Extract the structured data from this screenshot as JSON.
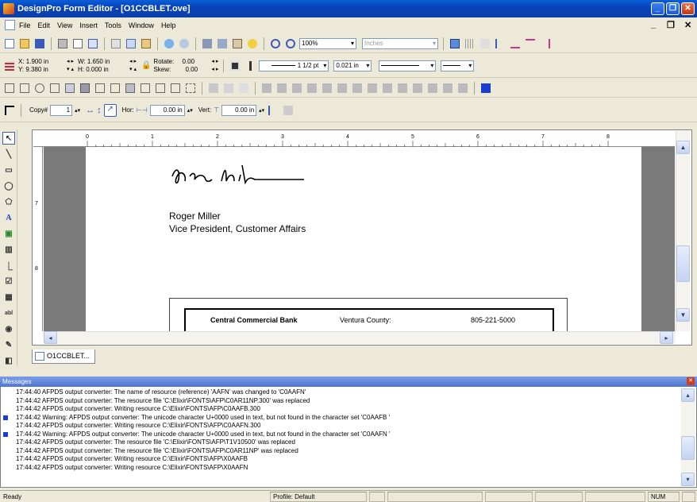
{
  "window": {
    "title": "DesignPro Form Editor - [O1CCBLET.ove]"
  },
  "menu": [
    "File",
    "Edit",
    "View",
    "Insert",
    "Tools",
    "Window",
    "Help"
  ],
  "toolbar1": {
    "zoom": "100%",
    "units": "Inches"
  },
  "toolbar2": {
    "x_label": "X:",
    "x_value": "1.900 in",
    "y_label": "Y:",
    "y_value": "9.380 in",
    "w_label": "W:",
    "w_value": "1.650 in",
    "h_label": "H:",
    "h_value": "0.000 in",
    "rotate_label": "Rotate:",
    "rotate_value": "0.00",
    "skew_label": "Skew:",
    "skew_value": "0.00",
    "line_weight": "1 1/2 pt",
    "line_width_in": "0.021 in"
  },
  "toolbar4": {
    "copy_label": "Copy#",
    "copy_value": "1",
    "hor_label": "Hor:",
    "hor_value": "0.00 in",
    "vert_label": "Vert:",
    "vert_value": "0.00 in"
  },
  "ruler": {
    "marks": [
      "0",
      "1",
      "2",
      "3",
      "4",
      "5",
      "6",
      "7",
      "8"
    ],
    "vmarks": [
      "7",
      "8"
    ]
  },
  "document": {
    "signer_name": "Roger Miller",
    "signer_title": "Vice President, Customer Affairs",
    "bank_name": "Central Commercial Bank",
    "county": "Ventura County:",
    "phone": "805-221-5000"
  },
  "doc_tab": "O1CCBLET...",
  "messages": {
    "title": "Messages",
    "lines": [
      {
        "text": "17:44:40  AFPDS output converter: The name of resource (reference) 'AAFN' was changed to 'C0AAFN'",
        "warn": false
      },
      {
        "text": "17:44:42  AFPDS output converter: The resource file 'C:\\Elixir\\FONTS\\AFP\\C0AR11NP.300' was replaced",
        "warn": false
      },
      {
        "text": "17:44:42  AFPDS output converter: Writing resource C:\\Elixir\\FONTS\\AFP\\C0AAFB.300",
        "warn": false
      },
      {
        "text": "17:44:42  Warning: AFPDS output converter: The unicode character U+0000 used in text, but not found in the character set 'C0AAFB '",
        "warn": true
      },
      {
        "text": "17:44:42  AFPDS output converter: Writing resource C:\\Elixir\\FONTS\\AFP\\C0AAFN.300",
        "warn": false
      },
      {
        "text": "17:44:42  Warning: AFPDS output converter: The unicode character U+0000 used in text, but not found in the character set 'C0AAFN '",
        "warn": true
      },
      {
        "text": "17:44:42  AFPDS output converter: The resource file 'C:\\Elixir\\FONTS\\AFP\\T1V10500' was replaced",
        "warn": false
      },
      {
        "text": "17:44:42  AFPDS output converter: The resource file 'C:\\Elixir\\FONTS\\AFP\\C0AR11NP' was replaced",
        "warn": false
      },
      {
        "text": "17:44:42  AFPDS output converter: Writing resource C:\\Elixir\\FONTS\\AFP\\X0AAFB",
        "warn": false
      },
      {
        "text": "17:44:42  AFPDS output converter: Writing resource C:\\Elixir\\FONTS\\AFP\\X0AAFN",
        "warn": false
      }
    ]
  },
  "status": {
    "ready": "Ready",
    "profile": "Profile: Default",
    "num": "NUM"
  },
  "colors": {
    "titlebar": "#0a5fd8",
    "warn_marker": "#1a3ccf",
    "messages_header": "#4f76d0"
  }
}
